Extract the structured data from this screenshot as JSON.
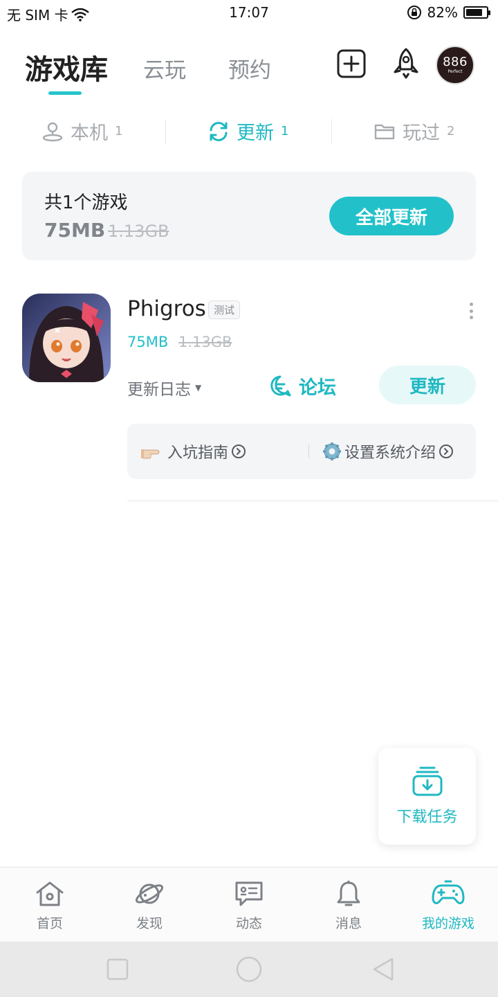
{
  "status_bar": {
    "carrier": "无 SIM 卡",
    "time": "17:07",
    "battery": "82%",
    "battery_level": 0.82
  },
  "header": {
    "tabs": [
      {
        "label": "游戏库",
        "active": true
      },
      {
        "label": "云玩",
        "active": false
      },
      {
        "label": "预约",
        "active": false
      }
    ],
    "icons": [
      "add-square-icon",
      "rocket-icon"
    ],
    "avatar": {
      "number": "886",
      "sub": "Perfect"
    }
  },
  "subtabs": [
    {
      "label": "本机",
      "count": "1",
      "icon": "user-location-icon",
      "active": false
    },
    {
      "label": "更新",
      "count": "1",
      "icon": "refresh-icon",
      "active": true
    },
    {
      "label": "玩过",
      "count": "2",
      "icon": "folder-icon",
      "active": false
    }
  ],
  "summary": {
    "title": "共1个游戏",
    "size": "75MB",
    "original_size": "1.13GB",
    "update_all_label": "全部更新"
  },
  "game": {
    "name": "Phigros",
    "badge": "测试",
    "size": "75MB",
    "original_size": "1.13GB",
    "changelog_label": "更新日志",
    "forum_label": "论坛",
    "update_label": "更新",
    "guides": [
      {
        "icon": "pointing-hand-icon",
        "label": "入坑指南"
      },
      {
        "icon": "gear-icon",
        "label": "设置系统介绍"
      }
    ]
  },
  "download_task": {
    "label": "下载任务"
  },
  "bottom_nav": [
    {
      "label": "首页",
      "icon": "home-icon",
      "active": false
    },
    {
      "label": "发现",
      "icon": "planet-icon",
      "active": false
    },
    {
      "label": "动态",
      "icon": "chat-card-icon",
      "active": false
    },
    {
      "label": "消息",
      "icon": "bell-icon",
      "active": false
    },
    {
      "label": "我的游戏",
      "icon": "gamepad-icon",
      "active": true
    }
  ],
  "colors": {
    "accent": "#22c1c9",
    "text_primary": "#222222",
    "text_muted": "#8a8f95",
    "card_bg": "#f4f5f7"
  }
}
